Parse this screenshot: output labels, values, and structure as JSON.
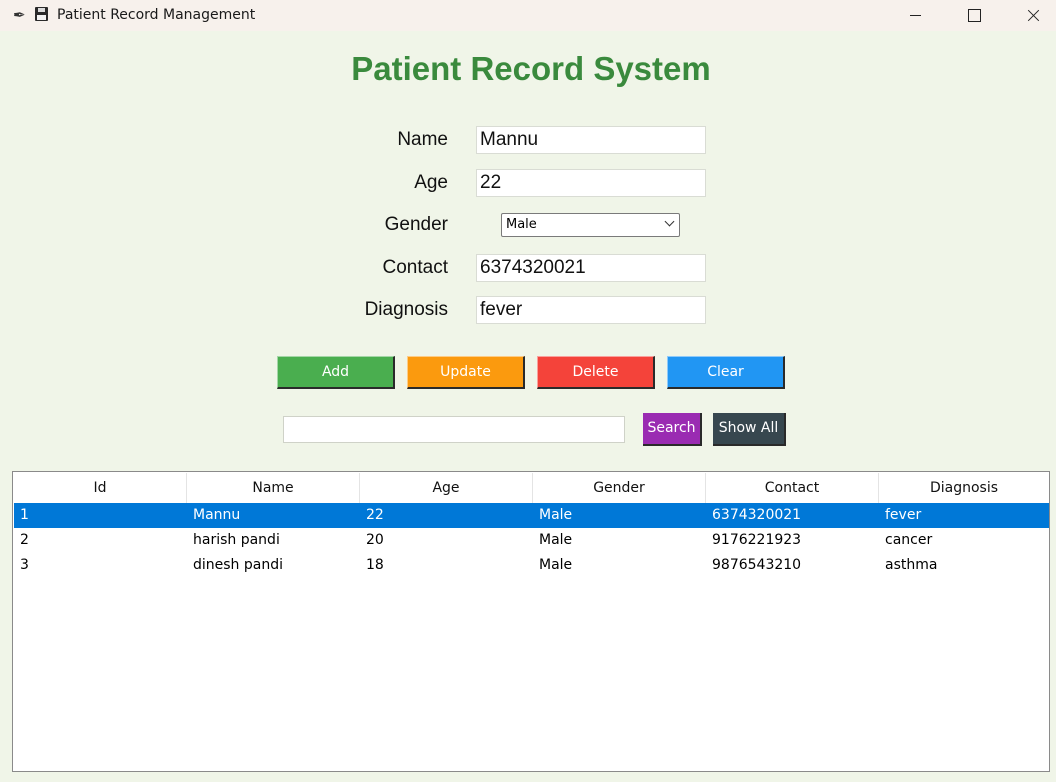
{
  "window": {
    "title": "Patient Record Management",
    "app_icon": "feather-icon",
    "secondary_icon": "floppy-disk-icon"
  },
  "heading": "Patient Record System",
  "form": {
    "name_label": "Name",
    "name_value": "Mannu",
    "age_label": "Age",
    "age_value": "22",
    "gender_label": "Gender",
    "gender_value": "Male",
    "contact_label": "Contact",
    "contact_value": "6374320021",
    "diagnosis_label": "Diagnosis",
    "diagnosis_value": "fever"
  },
  "actions": {
    "add": "Add",
    "update": "Update",
    "delete": "Delete",
    "clear": "Clear"
  },
  "search": {
    "value": "",
    "search_label": "Search",
    "show_all_label": "Show All"
  },
  "table": {
    "columns": [
      "Id",
      "Name",
      "Age",
      "Gender",
      "Contact",
      "Diagnosis"
    ],
    "rows": [
      {
        "id": "1",
        "name": "Mannu",
        "age": "22",
        "gender": "Male",
        "contact": "6374320021",
        "diagnosis": "fever",
        "selected": true
      },
      {
        "id": "2",
        "name": "harish pandi",
        "age": "20",
        "gender": "Male",
        "contact": "9176221923",
        "diagnosis": "cancer",
        "selected": false
      },
      {
        "id": "3",
        "name": "dinesh pandi",
        "age": "18",
        "gender": "Male",
        "contact": "9876543210",
        "diagnosis": "asthma",
        "selected": false
      }
    ]
  },
  "colors": {
    "heading": "#3a8a3d",
    "add": "#4aae4f",
    "update": "#fb9a0e",
    "delete": "#f4433a",
    "clear": "#2196f3",
    "search": "#9a2bb2",
    "show_all": "#37474f",
    "selection": "#0078d7",
    "background": "#f0f5e8"
  }
}
